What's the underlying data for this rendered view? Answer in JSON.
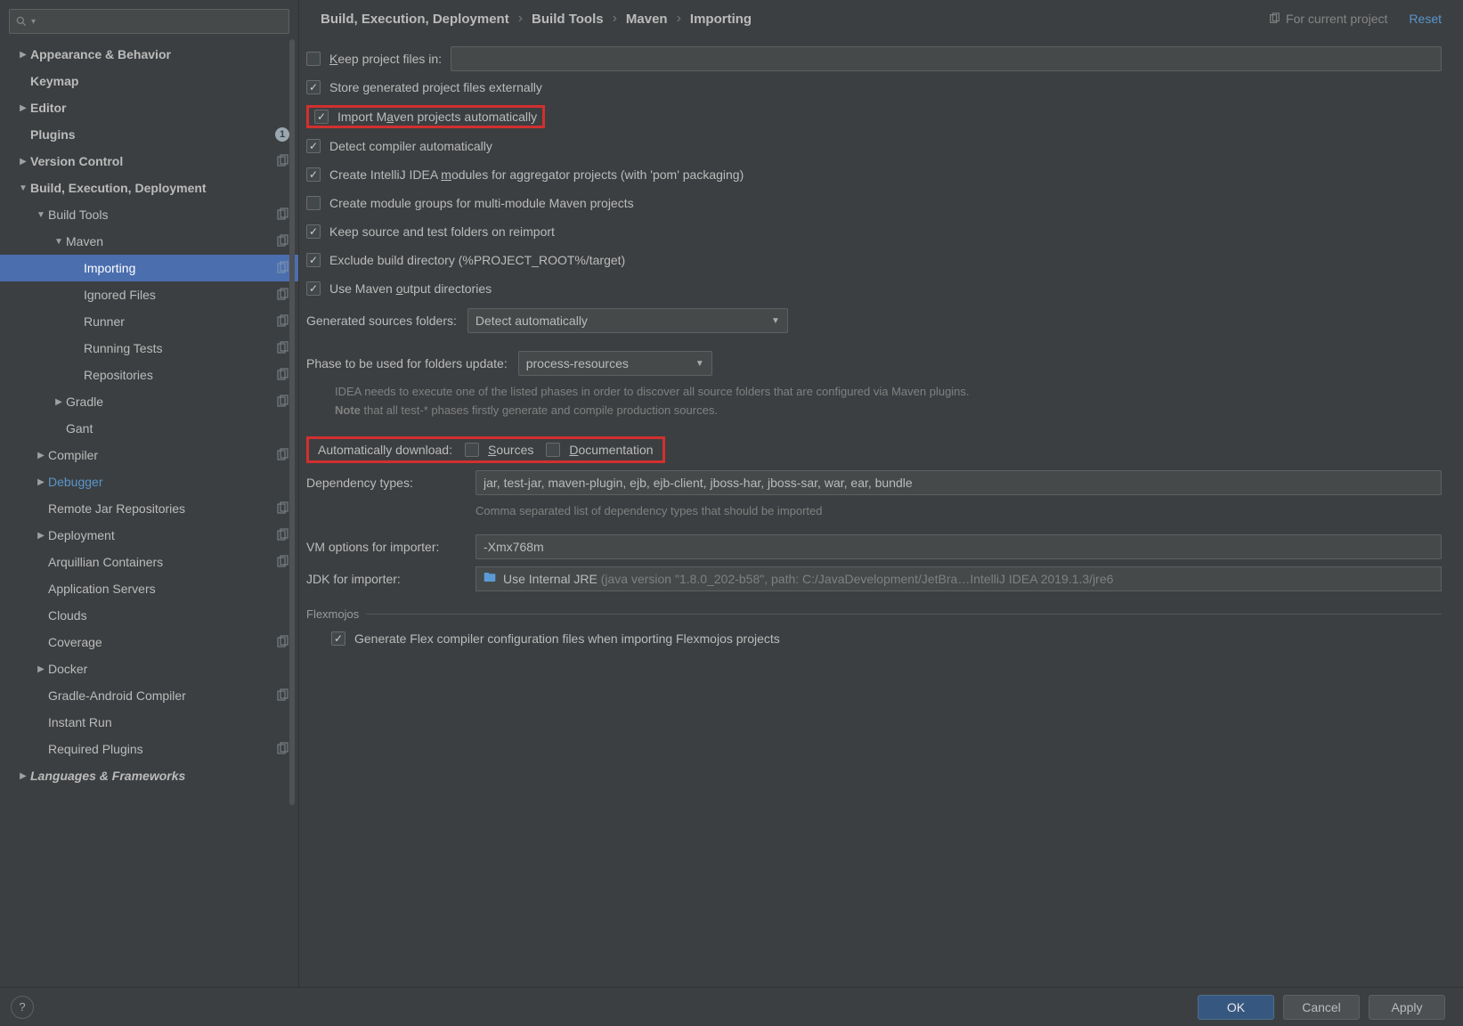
{
  "sidebar": {
    "search_placeholder": "",
    "items": [
      {
        "label": "Appearance & Behavior",
        "depth": 0,
        "arrow": "right"
      },
      {
        "label": "Keymap",
        "depth": 0,
        "arrow": "none"
      },
      {
        "label": "Editor",
        "depth": 0,
        "arrow": "right"
      },
      {
        "label": "Plugins",
        "depth": 0,
        "arrow": "none",
        "badge": "1"
      },
      {
        "label": "Version Control",
        "depth": 0,
        "arrow": "right",
        "trailing": "copy"
      },
      {
        "label": "Build, Execution, Deployment",
        "depth": 0,
        "arrow": "down"
      },
      {
        "label": "Build Tools",
        "depth": 1,
        "arrow": "down",
        "trailing": "copy"
      },
      {
        "label": "Maven",
        "depth": 2,
        "arrow": "down",
        "trailing": "copy"
      },
      {
        "label": "Importing",
        "depth": 3,
        "arrow": "none",
        "selected": true,
        "trailing": "copy"
      },
      {
        "label": "Ignored Files",
        "depth": 3,
        "arrow": "none",
        "trailing": "copy"
      },
      {
        "label": "Runner",
        "depth": 3,
        "arrow": "none",
        "trailing": "copy"
      },
      {
        "label": "Running Tests",
        "depth": 3,
        "arrow": "none",
        "trailing": "copy"
      },
      {
        "label": "Repositories",
        "depth": 3,
        "arrow": "none",
        "trailing": "copy"
      },
      {
        "label": "Gradle",
        "depth": 2,
        "arrow": "right",
        "trailing": "copy"
      },
      {
        "label": "Gant",
        "depth": 2,
        "arrow": "none"
      },
      {
        "label": "Compiler",
        "depth": 1,
        "arrow": "right",
        "trailing": "copy"
      },
      {
        "label": "Debugger",
        "depth": 1,
        "arrow": "right",
        "active": true
      },
      {
        "label": "Remote Jar Repositories",
        "depth": 1,
        "arrow": "none",
        "trailing": "copy"
      },
      {
        "label": "Deployment",
        "depth": 1,
        "arrow": "right",
        "trailing": "copy"
      },
      {
        "label": "Arquillian Containers",
        "depth": 1,
        "arrow": "none",
        "trailing": "copy"
      },
      {
        "label": "Application Servers",
        "depth": 1,
        "arrow": "none"
      },
      {
        "label": "Clouds",
        "depth": 1,
        "arrow": "none"
      },
      {
        "label": "Coverage",
        "depth": 1,
        "arrow": "none",
        "trailing": "copy"
      },
      {
        "label": "Docker",
        "depth": 1,
        "arrow": "right"
      },
      {
        "label": "Gradle-Android Compiler",
        "depth": 1,
        "arrow": "none",
        "trailing": "copy"
      },
      {
        "label": "Instant Run",
        "depth": 1,
        "arrow": "none"
      },
      {
        "label": "Required Plugins",
        "depth": 1,
        "arrow": "none",
        "trailing": "copy"
      },
      {
        "label": "Languages & Frameworks",
        "depth": 0,
        "arrow": "right",
        "italic": true
      }
    ]
  },
  "breadcrumb": [
    "Build, Execution, Deployment",
    "Build Tools",
    "Maven",
    "Importing"
  ],
  "header_hint": "For current project",
  "reset": "Reset",
  "checks": {
    "keep_files": {
      "label": "Keep project files in:",
      "checked": false,
      "ul": "K"
    },
    "store_ext": {
      "label": "Store generated project files externally",
      "checked": true
    },
    "import_auto": {
      "label": "Import Maven projects automatically",
      "checked": true,
      "ul": "a",
      "highlight": true
    },
    "detect_compiler": {
      "label": "Detect compiler automatically",
      "checked": true
    },
    "create_modules": {
      "label": "Create IntelliJ IDEA modules for aggregator projects (with 'pom' packaging)",
      "checked": true,
      "ul": "m"
    },
    "create_groups": {
      "label": "Create module groups for multi-module Maven projects",
      "checked": false,
      "ul": "g"
    },
    "keep_src": {
      "label": "Keep source and test folders on reimport",
      "checked": true
    },
    "exclude_build": {
      "label": "Exclude build directory (%PROJECT_ROOT%/target)",
      "checked": true
    },
    "use_output": {
      "label": "Use Maven output directories",
      "checked": true,
      "ul": "o"
    }
  },
  "gen_src": {
    "label": "Generated sources folders:",
    "value": "Detect automatically"
  },
  "phase": {
    "label": "Phase to be used for folders update:",
    "value": "process-resources"
  },
  "phase_help1": "IDEA needs to execute one of the listed phases in order to discover all source folders that are configured via Maven plugins.",
  "phase_help2_prefix": "Note",
  "phase_help2": " that all test-* phases firstly generate and compile production sources.",
  "auto_dl": {
    "label": "Automatically download:",
    "sources": "Sources",
    "docs": "Documentation",
    "ul_s": "S",
    "ul_d": "D",
    "highlight": true
  },
  "dep_types": {
    "label": "Dependency types:",
    "value": "jar, test-jar, maven-plugin, ejb, ejb-client, jboss-har, jboss-sar, war, ear, bundle"
  },
  "dep_help": "Comma separated list of dependency types that should be imported",
  "vm_opts": {
    "label": "VM options for importer:",
    "value": "-Xmx768m"
  },
  "jdk": {
    "label": "JDK for importer:",
    "value": "Use Internal JRE",
    "detail": " (java version \"1.8.0_202-b58\", path: C:/JavaDevelopment/JetBra…IntelliJ IDEA 2019.1.3/jre6"
  },
  "flex": {
    "section": "Flexmojos",
    "label": "Generate Flex compiler configuration files when importing Flexmojos projects",
    "checked": true
  },
  "footer": {
    "ok": "OK",
    "cancel": "Cancel",
    "apply": "Apply",
    "help": "?"
  }
}
